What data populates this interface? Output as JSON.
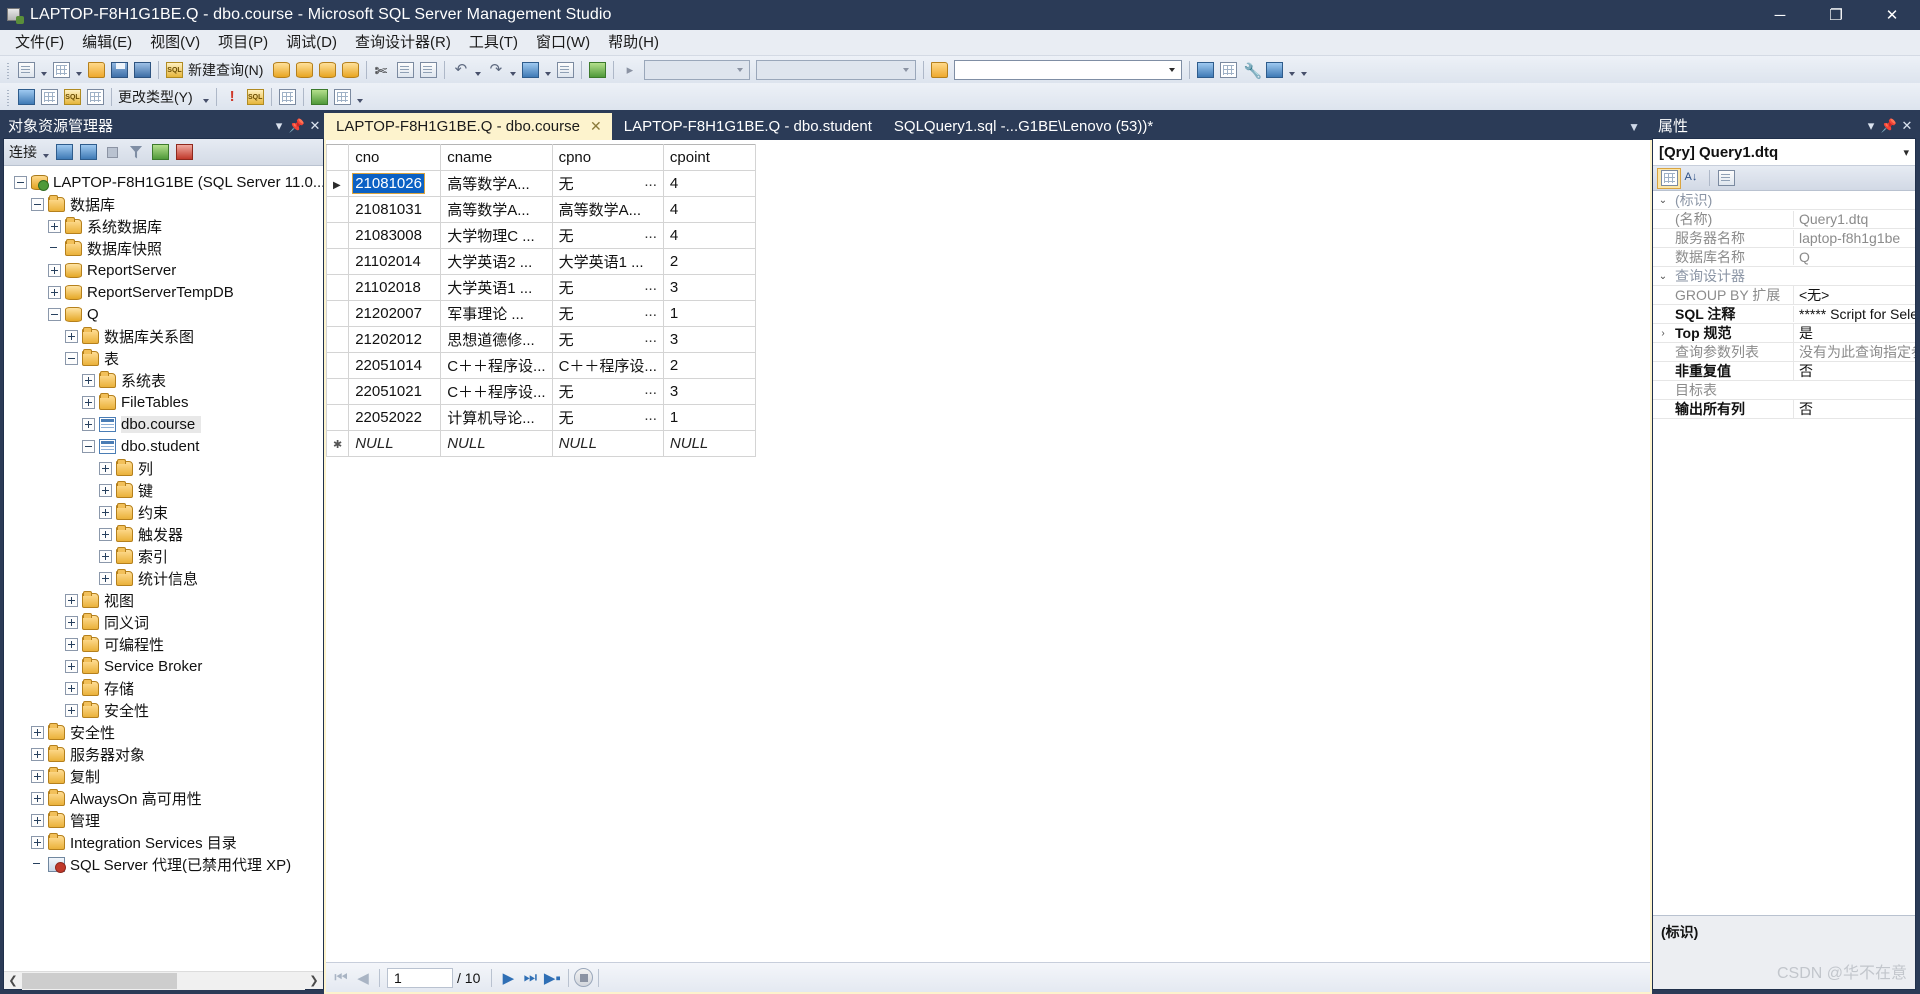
{
  "window": {
    "title": "LAPTOP-F8H1G1BE.Q - dbo.course - Microsoft SQL Server Management Studio",
    "minimize": "─",
    "maximize": "❐",
    "close": "✕"
  },
  "menubar": {
    "items": [
      {
        "label": "文件(F)"
      },
      {
        "label": "编辑(E)"
      },
      {
        "label": "视图(V)"
      },
      {
        "label": "项目(P)"
      },
      {
        "label": "调试(D)"
      },
      {
        "label": "查询设计器(R)"
      },
      {
        "label": "工具(T)"
      },
      {
        "label": "窗口(W)"
      },
      {
        "label": "帮助(H)"
      }
    ]
  },
  "toolbar": {
    "new_query_label": "新建查询(N)",
    "change_type_label": "更改类型(Y)",
    "combo1_value": "",
    "combo2_value": "",
    "combo3_value": ""
  },
  "object_explorer": {
    "title": "对象资源管理器",
    "connect_label": "连接",
    "tree": [
      {
        "label": "LAPTOP-F8H1G1BE (SQL Server 11.0...",
        "indent": 0,
        "state": "minus",
        "icon": "server-icon",
        "selected": false
      },
      {
        "label": "数据库",
        "indent": 1,
        "state": "minus",
        "icon": "folder-icon",
        "selected": false
      },
      {
        "label": "系统数据库",
        "indent": 2,
        "state": "plus",
        "icon": "folder-icon",
        "selected": false
      },
      {
        "label": "数据库快照",
        "indent": 2,
        "state": "none",
        "icon": "folder-icon",
        "selected": false
      },
      {
        "label": "ReportServer",
        "indent": 2,
        "state": "plus",
        "icon": "database-icon",
        "selected": false
      },
      {
        "label": "ReportServerTempDB",
        "indent": 2,
        "state": "plus",
        "icon": "database-icon",
        "selected": false
      },
      {
        "label": "Q",
        "indent": 2,
        "state": "minus",
        "icon": "database-icon",
        "selected": false
      },
      {
        "label": "数据库关系图",
        "indent": 3,
        "state": "plus",
        "icon": "folder-icon",
        "selected": false
      },
      {
        "label": "表",
        "indent": 3,
        "state": "minus",
        "icon": "folder-icon",
        "selected": false
      },
      {
        "label": "系统表",
        "indent": 4,
        "state": "plus",
        "icon": "folder-icon",
        "selected": false
      },
      {
        "label": "FileTables",
        "indent": 4,
        "state": "plus",
        "icon": "folder-icon",
        "selected": false
      },
      {
        "label": "dbo.course",
        "indent": 4,
        "state": "plus",
        "icon": "table-icon",
        "selected": true
      },
      {
        "label": "dbo.student",
        "indent": 4,
        "state": "minus",
        "icon": "table-icon",
        "selected": false
      },
      {
        "label": "列",
        "indent": 5,
        "state": "plus",
        "icon": "folder-icon",
        "selected": false
      },
      {
        "label": "键",
        "indent": 5,
        "state": "plus",
        "icon": "folder-icon",
        "selected": false
      },
      {
        "label": "约束",
        "indent": 5,
        "state": "plus",
        "icon": "folder-icon",
        "selected": false
      },
      {
        "label": "触发器",
        "indent": 5,
        "state": "plus",
        "icon": "folder-icon",
        "selected": false
      },
      {
        "label": "索引",
        "indent": 5,
        "state": "plus",
        "icon": "folder-icon",
        "selected": false
      },
      {
        "label": "统计信息",
        "indent": 5,
        "state": "plus",
        "icon": "folder-icon",
        "selected": false
      },
      {
        "label": "视图",
        "indent": 3,
        "state": "plus",
        "icon": "folder-icon",
        "selected": false
      },
      {
        "label": "同义词",
        "indent": 3,
        "state": "plus",
        "icon": "folder-icon",
        "selected": false
      },
      {
        "label": "可编程性",
        "indent": 3,
        "state": "plus",
        "icon": "folder-icon",
        "selected": false
      },
      {
        "label": "Service Broker",
        "indent": 3,
        "state": "plus",
        "icon": "folder-icon",
        "selected": false
      },
      {
        "label": "存储",
        "indent": 3,
        "state": "plus",
        "icon": "folder-icon",
        "selected": false
      },
      {
        "label": "安全性",
        "indent": 3,
        "state": "plus",
        "icon": "folder-icon",
        "selected": false
      },
      {
        "label": "安全性",
        "indent": 1,
        "state": "plus",
        "icon": "folder-icon",
        "selected": false
      },
      {
        "label": "服务器对象",
        "indent": 1,
        "state": "plus",
        "icon": "folder-icon",
        "selected": false
      },
      {
        "label": "复制",
        "indent": 1,
        "state": "plus",
        "icon": "folder-icon",
        "selected": false
      },
      {
        "label": "AlwaysOn 高可用性",
        "indent": 1,
        "state": "plus",
        "icon": "folder-icon",
        "selected": false
      },
      {
        "label": "管理",
        "indent": 1,
        "state": "plus",
        "icon": "folder-icon",
        "selected": false
      },
      {
        "label": "Integration Services 目录",
        "indent": 1,
        "state": "plus",
        "icon": "folder-icon",
        "selected": false
      },
      {
        "label": "SQL Server 代理(已禁用代理 XP)",
        "indent": 1,
        "state": "none",
        "icon": "agent-icon",
        "selected": false
      }
    ]
  },
  "tabs": [
    {
      "label": "LAPTOP-F8H1G1BE.Q - dbo.course",
      "active": true,
      "closable": true
    },
    {
      "label": "LAPTOP-F8H1G1BE.Q - dbo.student",
      "active": false,
      "closable": false
    },
    {
      "label": "SQLQuery1.sql -...G1BE\\Lenovo (53))*",
      "active": false,
      "closable": false
    }
  ],
  "grid": {
    "columns": [
      "cno",
      "cname",
      "cpno",
      "cpoint"
    ],
    "selected_cell": {
      "row": 0,
      "col": 0
    },
    "ellipsis": "...",
    "null_text": "NULL",
    "rows": [
      {
        "current": true,
        "cno": "21081026",
        "cname": "高等数学A...",
        "cpno": "无",
        "cpno_ell": true,
        "cpoint": "4"
      },
      {
        "current": false,
        "cno": "21081031",
        "cname": "高等数学A...",
        "cpno": "高等数学A...",
        "cpno_ell": false,
        "cpoint": "4"
      },
      {
        "current": false,
        "cno": "21083008",
        "cname": "大学物理C ...",
        "cpno": "无",
        "cpno_ell": true,
        "cpoint": "4"
      },
      {
        "current": false,
        "cno": "21102014",
        "cname": "大学英语2 ...",
        "cpno": "大学英语1 ...",
        "cpno_ell": false,
        "cpoint": "2"
      },
      {
        "current": false,
        "cno": "21102018",
        "cname": "大学英语1 ...",
        "cpno": "无",
        "cpno_ell": true,
        "cpoint": "3"
      },
      {
        "current": false,
        "cno": "21202007",
        "cname": "军事理论  ...",
        "cpno": "无",
        "cpno_ell": true,
        "cpoint": "1"
      },
      {
        "current": false,
        "cno": "21202012",
        "cname": "思想道德修...",
        "cpno": "无",
        "cpno_ell": true,
        "cpoint": "3"
      },
      {
        "current": false,
        "cno": "22051014",
        "cname": "C＋＋程序设...",
        "cpno": "C＋＋程序设...",
        "cpno_ell": false,
        "cpoint": "2"
      },
      {
        "current": false,
        "cno": "22051021",
        "cname": "C＋＋程序设...",
        "cpno": "无",
        "cpno_ell": true,
        "cpoint": "3"
      },
      {
        "current": false,
        "cno": "22052022",
        "cname": "计算机导论...",
        "cpno": "无",
        "cpno_ell": true,
        "cpoint": "1"
      }
    ]
  },
  "grid_nav": {
    "current_page": "1",
    "total": "/ 10"
  },
  "properties": {
    "header": "属性",
    "object": "[Qry] Query1.dtq",
    "rows": [
      {
        "type": "category",
        "expander": "⌄",
        "name": "(标识)",
        "value": ""
      },
      {
        "type": "prop",
        "expander": "",
        "name": "(名称)",
        "value": "Query1.dtq",
        "name_gray": true,
        "value_gray": true
      },
      {
        "type": "prop",
        "expander": "",
        "name": "服务器名称",
        "value": "laptop-f8h1g1be",
        "name_gray": true,
        "value_gray": true
      },
      {
        "type": "prop",
        "expander": "",
        "name": "数据库名称",
        "value": "Q",
        "name_gray": true,
        "value_gray": true
      },
      {
        "type": "category",
        "expander": "⌄",
        "name": "查询设计器",
        "value": ""
      },
      {
        "type": "prop",
        "expander": "",
        "name": "GROUP BY 扩展",
        "value": "<无>",
        "name_gray": true,
        "value_gray": false
      },
      {
        "type": "prop",
        "expander": "",
        "name": "SQL 注释",
        "value": "***** Script for Select",
        "name_gray": false,
        "value_gray": false
      },
      {
        "type": "prop",
        "expander": "›",
        "name": "Top 规范",
        "value": "是",
        "name_gray": false,
        "value_gray": false
      },
      {
        "type": "prop",
        "expander": "",
        "name": "查询参数列表",
        "value": "没有为此查询指定参数",
        "name_gray": true,
        "value_gray": true
      },
      {
        "type": "prop",
        "expander": "",
        "name": "非重复值",
        "value": "否",
        "name_gray": false,
        "value_gray": false
      },
      {
        "type": "prop",
        "expander": "",
        "name": "目标表",
        "value": "",
        "name_gray": true,
        "value_gray": true
      },
      {
        "type": "prop",
        "expander": "",
        "name": "输出所有列",
        "value": "否",
        "name_gray": false,
        "value_gray": false
      }
    ],
    "footer_title": "(标识)",
    "watermark": "CSDN @华不在意"
  }
}
